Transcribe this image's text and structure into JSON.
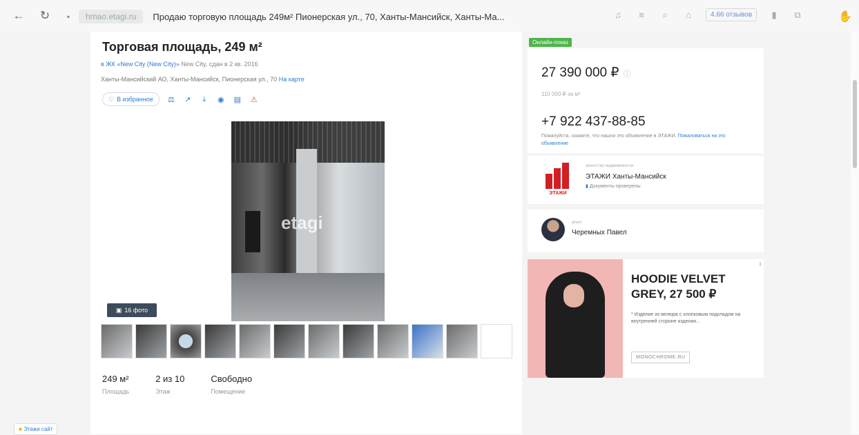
{
  "browser": {
    "domain": "hmao.etagi.ru",
    "tab_title": "Продаю торговую площадь 249м² Пионерская ул., 70, Ханты-Мансийск, Ханты-Ма...",
    "reviews": "4.66 отзывов"
  },
  "listing": {
    "title": "Торговая площадь, 249 м²",
    "meta_link": "в ЖК «New City (New City)»",
    "meta_rest": " New City, сдан в 2 кв. 2016",
    "address": "Ханты-Мансийский АО, Ханты-Мансийск, Пионерская ул., 70",
    "map_link": "На карте",
    "favorite_label": "В избранное",
    "photo_watermark": "etagi",
    "photo_count": "16 фото",
    "facts": [
      {
        "value": "249 м²",
        "label": "Площадь"
      },
      {
        "value": "2 из 10",
        "label": "Этаж"
      },
      {
        "value": "Свободно",
        "label": "Помещение"
      }
    ]
  },
  "sidebar": {
    "online_badge": "Онлайн-показ",
    "price": "27 390 000 ₽",
    "price_per_m2": "110 000 ₽ за м²",
    "phone": "+7 922 437-88-85",
    "phone_note": "Пожалуйста, скажите, что нашли это объявление в ЭТАЖИ.",
    "phone_note_link": "Пожаловаться на это объявление",
    "agency_caption": "агентство недвижимости",
    "agency_name": "ЭТАЖИ Ханты-Мансийск",
    "agency_docs": "Документы проверены",
    "agency_logo_text": "ЭТАЖИ",
    "agent_caption": "агент",
    "agent_name": "Черемных Павел"
  },
  "ad": {
    "title": "HOODIE VELVET GREY, 27 500 ₽",
    "desc": "* Изделие из велюра с хлопковым подкладом на внутренней стороне изделия...",
    "button": "MONOCHROME.RU",
    "info": "i"
  },
  "bottom_chip": "Этажи сайт"
}
